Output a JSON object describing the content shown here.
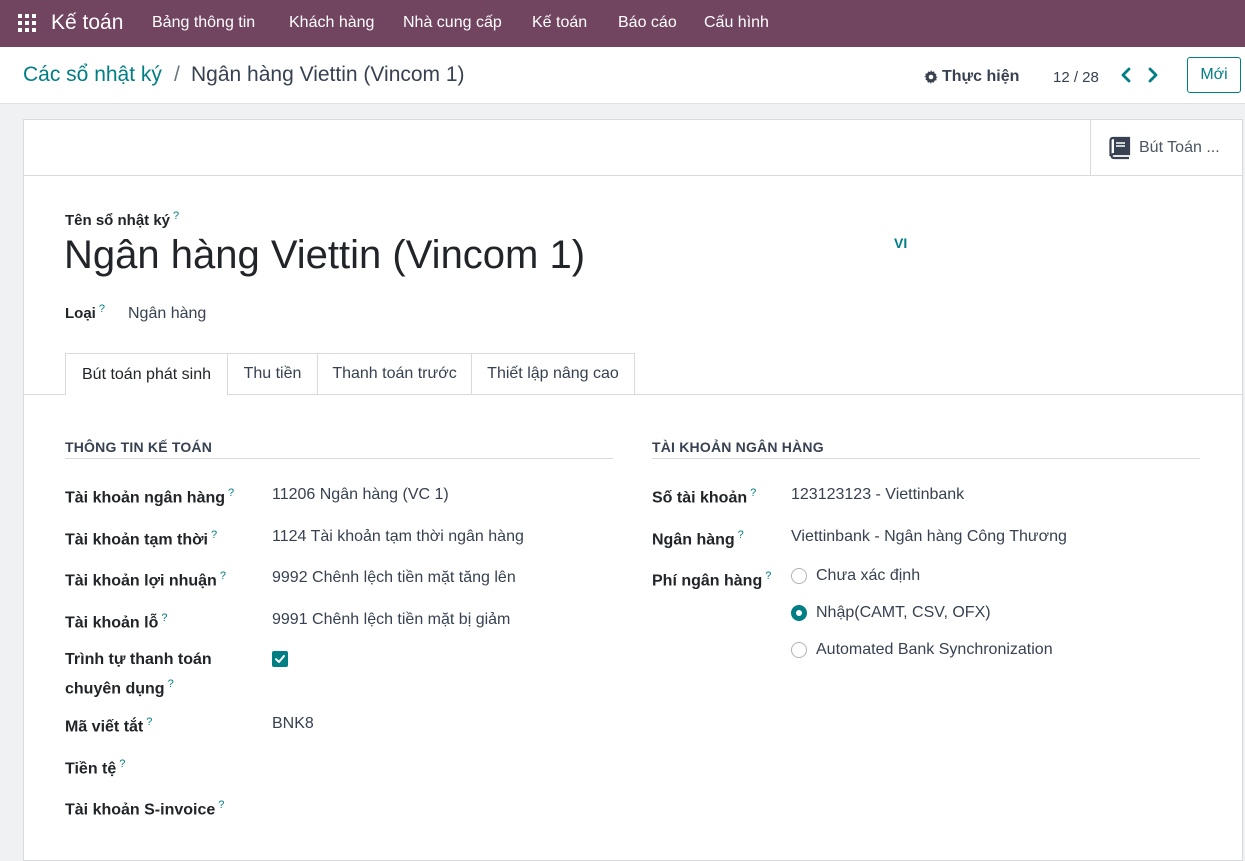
{
  "nav": {
    "app_name": "Kế toán",
    "menu": [
      "Bảng thông tin",
      "Khách hàng",
      "Nhà cung cấp",
      "Kế toán",
      "Báo cáo",
      "Cấu hình"
    ]
  },
  "control": {
    "breadcrumb_parent": "Các sổ nhật ký",
    "breadcrumb_sep": "/",
    "breadcrumb_current": "Ngân hàng Viettin (Vincom 1)",
    "action_label": "Thực hiện",
    "pager_value": "12 / 28",
    "new_label": "Mới"
  },
  "smart_button": {
    "label": "Bút Toán ..."
  },
  "form": {
    "name_label": "Tên sổ nhật ký",
    "name_value": "Ngân hàng Viettin (Vincom 1)",
    "lang": "VI",
    "type_label": "Loại",
    "type_value": "Ngân hàng",
    "help_mark": "?"
  },
  "tabs": [
    "Bút toán phát sinh",
    "Thu tiền",
    "Thanh toán trước",
    "Thiết lập nâng cao"
  ],
  "accounting": {
    "title": "THÔNG TIN KẾ TOÁN",
    "fields": [
      {
        "label": "Tài khoản ngân hàng",
        "value": "11206 Ngân hàng (VC 1)"
      },
      {
        "label": "Tài khoản tạm thời",
        "value": "1124 Tài khoản tạm thời ngân hàng"
      },
      {
        "label": "Tài khoản lợi nhuận",
        "value": "9992 Chênh lệch tiền mặt tăng lên"
      },
      {
        "label": "Tài khoản lỗ",
        "value": "9991 Chênh lệch tiền mặt bị giảm"
      },
      {
        "label_line1": "Trình tự thanh toán",
        "label_line2": "chuyên dụng",
        "checked": true
      },
      {
        "label": "Mã viết tắt",
        "value": "BNK8"
      },
      {
        "label": "Tiền tệ",
        "value": ""
      },
      {
        "label": "Tài khoản S-invoice",
        "value": ""
      }
    ]
  },
  "bank": {
    "title": "TÀI KHOẢN NGÂN HÀNG",
    "fields": [
      {
        "label": "Số tài khoản",
        "value": "123123123 - Viettinbank"
      },
      {
        "label": "Ngân hàng",
        "value": "Viettinbank - Ngân hàng Công Thương"
      },
      {
        "label": "Phí ngân hàng"
      }
    ],
    "feed_options": [
      {
        "label": "Chưa xác định",
        "selected": false
      },
      {
        "label": "Nhập(CAMT, CSV, OFX)",
        "selected": true
      },
      {
        "label": "Automated Bank Synchronization",
        "selected": false
      }
    ]
  },
  "colors": {
    "nav_bg": "#71445f",
    "accent": "#017e84"
  }
}
